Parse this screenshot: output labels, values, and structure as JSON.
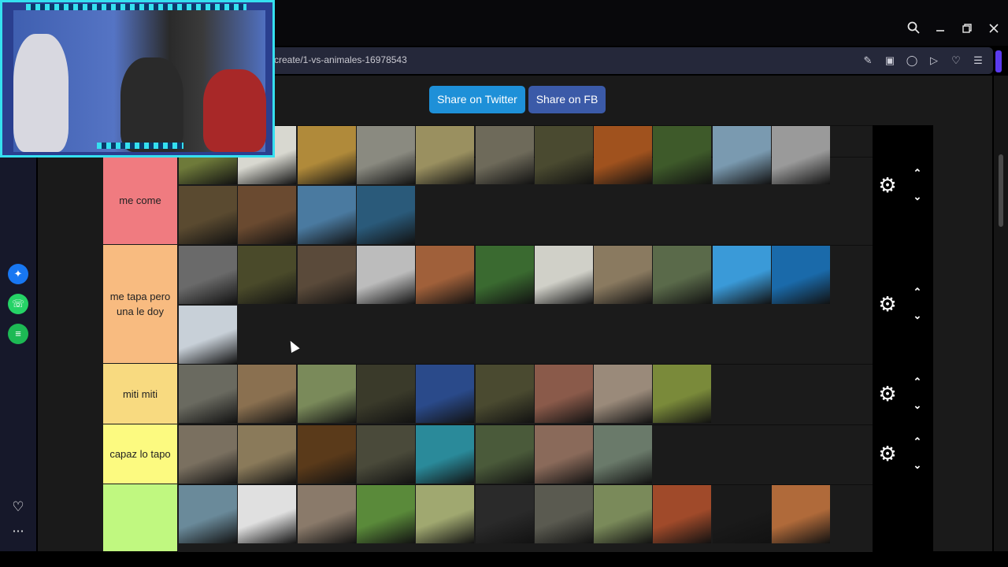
{
  "browser": {
    "url": "create/1-vs-animales-16978543",
    "toolbar_icons": [
      "edit-icon",
      "camera-icon",
      "shield-icon",
      "send-icon",
      "heart-icon",
      "menu-icon"
    ],
    "window_controls": [
      "search-icon",
      "minimize-icon",
      "restore-icon",
      "close-icon"
    ]
  },
  "sidebar": {
    "icons": [
      "messenger-icon",
      "whatsapp-icon",
      "spotify-icon",
      "heart-icon",
      "more-icon"
    ],
    "colors": {
      "messenger": "#1877f2",
      "whatsapp": "#25d366",
      "spotify": "#1db954"
    }
  },
  "share": {
    "twitter_label": "Share on Twitter",
    "fb_label": "Share on FB",
    "twitter_color": "#1e90d8",
    "fb_color": "#3b5aa8"
  },
  "tiers": [
    {
      "label": "me come",
      "color": "#f07b80"
    },
    {
      "label": "me tapa pero una le doy",
      "color": "#f8bb80"
    },
    {
      "label": "miti miti",
      "color": "#f8da80"
    },
    {
      "label": "capaz lo tapo",
      "color": "#fcfa80"
    },
    {
      "label": "",
      "color": "#c0f880"
    }
  ],
  "tile_palette": {
    "row0": [
      "#6e7a3a",
      "#d8d8d0",
      "#b08a3a",
      "#8a8a80",
      "#9a9060",
      "#6e6a5a",
      "#4a4a30",
      "#a0521e",
      "#3e5a2a",
      "#7a9ab0",
      "#9a9a9a"
    ],
    "row1": [
      "#5a4a30",
      "#6a4a30",
      "#4a7aa0",
      "#2a5a7a"
    ],
    "row2": [
      "#6a6a6a",
      "#4a4a2a",
      "#5a4a3a",
      "#bcbcbc",
      "#a0603a",
      "#3a6a30",
      "#d0d0c8",
      "#8a7a60",
      "#5a6a4a",
      "#3a9ad8",
      "#1a6aaa"
    ],
    "row3": [
      "#c8d0d8"
    ],
    "row4": [
      "#6a6a60",
      "#8a7050",
      "#7a8a5a",
      "#3a3a2a",
      "#2a4a8a",
      "#4a4a30",
      "#8a5a4a",
      "#9a8a7a",
      "#7a8a3a"
    ],
    "row5": [
      "#7a7060",
      "#8a7a5a",
      "#5a3a1a",
      "#4a4a3a",
      "#2a8a9a",
      "#4a5a3a",
      "#8a6a5a",
      "#6a7a6a"
    ],
    "row6": [
      "#6a8a9a",
      "#e0e0e0",
      "#8a7a6a",
      "#5a8a3a",
      "#a0a870",
      "#2a2a2a",
      "#5a5a50",
      "#7a8a5a",
      "#a04a2a",
      "#1a1a1a",
      "#b06a3a"
    ]
  }
}
